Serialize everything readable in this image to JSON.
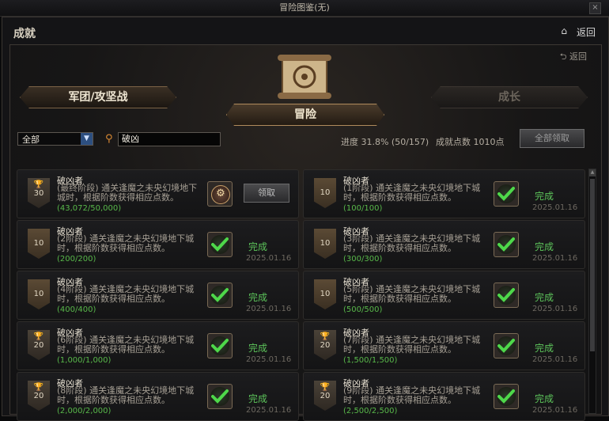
{
  "window": {
    "title": "冒险图鉴(无)",
    "close": "×"
  },
  "header": {
    "title": "成就",
    "home_icon": "⌂",
    "back": "返回"
  },
  "panel": {
    "back": "⮌ 返回"
  },
  "tabs": {
    "legion": "军团/攻坚战",
    "adventure": "冒险",
    "growth": "成长"
  },
  "filter": {
    "selected": "全部",
    "arrow": "▼"
  },
  "search": {
    "value": "破凶"
  },
  "stats": {
    "progress": "进度  31.8% (50/157)",
    "points": "成就点数  1010点"
  },
  "claim_all": "全部领取",
  "cards": [
    {
      "name": "破凶者",
      "desc": "(最终阶段) 通关逢魔之未央幻境地下城时，根据阶数获得相应点数。",
      "progress": "(43,072/50,000)",
      "badge": "30",
      "badge_type": "cup",
      "reward": "gear",
      "status": "",
      "date": "",
      "action": "领取"
    },
    {
      "name": "破凶者",
      "desc": "(1阶段) 通关逢魔之未央幻境地下城时，根据阶数获得相应点数。",
      "progress": "(100/100)",
      "badge": "10",
      "badge_type": "plain",
      "reward": "check",
      "status": "完成",
      "date": "2025.01.16",
      "action": ""
    },
    {
      "name": "破凶者",
      "desc": "(2阶段) 通关逢魔之未央幻境地下城时，根据阶数获得相应点数。",
      "progress": "(200/200)",
      "badge": "10",
      "badge_type": "plain",
      "reward": "check",
      "status": "完成",
      "date": "2025.01.16",
      "action": ""
    },
    {
      "name": "破凶者",
      "desc": "(3阶段) 通关逢魔之未央幻境地下城时，根据阶数获得相应点数。",
      "progress": "(300/300)",
      "badge": "10",
      "badge_type": "plain",
      "reward": "check",
      "status": "完成",
      "date": "2025.01.16",
      "action": ""
    },
    {
      "name": "破凶者",
      "desc": "(4阶段) 通关逢魔之未央幻境地下城时，根据阶数获得相应点数。",
      "progress": "(400/400)",
      "badge": "10",
      "badge_type": "plain",
      "reward": "check",
      "status": "完成",
      "date": "2025.01.16",
      "action": ""
    },
    {
      "name": "破凶者",
      "desc": "(5阶段) 通关逢魔之未央幻境地下城时，根据阶数获得相应点数。",
      "progress": "(500/500)",
      "badge": "10",
      "badge_type": "plain",
      "reward": "check",
      "status": "完成",
      "date": "2025.01.16",
      "action": ""
    },
    {
      "name": "破凶者",
      "desc": "(6阶段) 通关逢魔之未央幻境地下城时，根据阶数获得相应点数。",
      "progress": "(1,000/1,000)",
      "badge": "20",
      "badge_type": "cup",
      "reward": "check",
      "status": "完成",
      "date": "2025.01.16",
      "action": ""
    },
    {
      "name": "破凶者",
      "desc": "(7阶段) 通关逢魔之未央幻境地下城时，根据阶数获得相应点数。",
      "progress": "(1,500/1,500)",
      "badge": "20",
      "badge_type": "cup",
      "reward": "check",
      "status": "完成",
      "date": "2025.01.16",
      "action": ""
    },
    {
      "name": "破凶者",
      "desc": "(8阶段) 通关逢魔之未央幻境地下城时，根据阶数获得相应点数。",
      "progress": "(2,000/2,000)",
      "badge": "20",
      "badge_type": "cup",
      "reward": "check",
      "status": "完成",
      "date": "2025.01.16",
      "action": ""
    },
    {
      "name": "破凶者",
      "desc": "(9阶段) 通关逢魔之未央幻境地下城时，根据阶数获得相应点数。",
      "progress": "(2,500/2,500)",
      "badge": "20",
      "badge_type": "cup",
      "reward": "check",
      "status": "完成",
      "date": "2025.01.16",
      "action": ""
    }
  ]
}
